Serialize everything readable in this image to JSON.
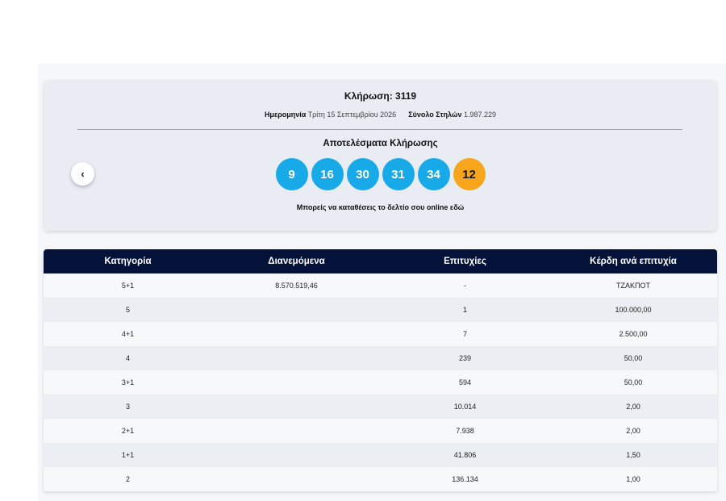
{
  "draw": {
    "title": "Κλήρωση: 3119",
    "date_label": "Ημερομηνία",
    "date_value": "Τρίτη 15 Σεπτεμβρίου 2026",
    "columns_label": "Σύνολο Στηλών",
    "columns_value": "1.987.229",
    "results_title": "Αποτελέσματα Κλήρωσης",
    "prev_icon": "‹",
    "numbers": [
      "9",
      "16",
      "30",
      "31",
      "34"
    ],
    "bonus": "12",
    "online_text": "Μπορείς να καταθέσεις το δελτίο σου online εδώ"
  },
  "table": {
    "headers": [
      "Κατηγορία",
      "Διανεμόμενα",
      "Επιτυχίες",
      "Κέρδη ανά επιτυχία"
    ],
    "rows": [
      [
        "5+1",
        "8.570.519,46",
        "-",
        "ΤΖΑΚΠΟΤ"
      ],
      [
        "5",
        "",
        "1",
        "100.000,00"
      ],
      [
        "4+1",
        "",
        "7",
        "2.500,00"
      ],
      [
        "4",
        "",
        "239",
        "50,00"
      ],
      [
        "3+1",
        "",
        "594",
        "50,00"
      ],
      [
        "3",
        "",
        "10.014",
        "2,00"
      ],
      [
        "2+1",
        "",
        "7.938",
        "2,00"
      ],
      [
        "1+1",
        "",
        "41.806",
        "1,50"
      ],
      [
        "2",
        "",
        "136.134",
        "1,00"
      ]
    ]
  },
  "colors": {
    "main_ball": "#18a9e8",
    "bonus_ball": "#f7a51c",
    "table_header": "#04123a"
  },
  "icons": {
    "prev": "chevron-left-icon"
  }
}
